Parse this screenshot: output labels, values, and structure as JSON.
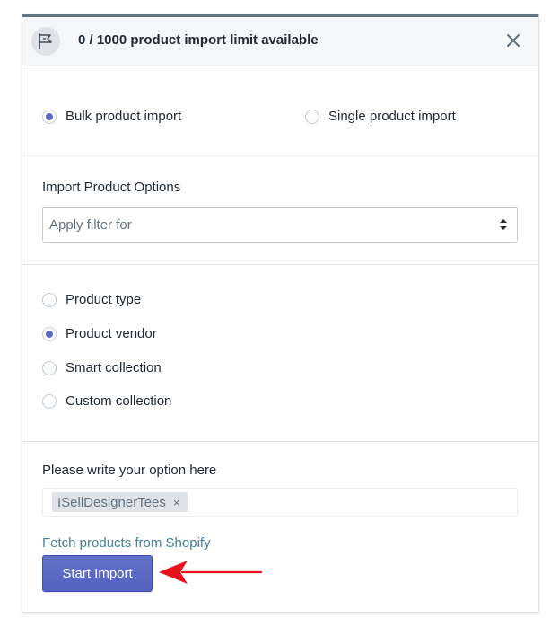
{
  "header": {
    "title": "0 / 1000 product import limit available",
    "icon": "flag-icon",
    "close_icon": "close-icon"
  },
  "import_mode": {
    "options": [
      {
        "label": "Bulk product import",
        "checked": true
      },
      {
        "label": "Single product import",
        "checked": false
      }
    ]
  },
  "import_options": {
    "label": "Import Product Options",
    "select_value": "Apply filter for"
  },
  "filter_types": {
    "options": [
      {
        "label": "Product type",
        "checked": false
      },
      {
        "label": "Product vendor",
        "checked": true
      },
      {
        "label": "Smart collection",
        "checked": false
      },
      {
        "label": "Custom collection",
        "checked": false
      }
    ]
  },
  "option_input": {
    "label": "Please write your option here",
    "tags": [
      "ISellDesignerTees"
    ],
    "remove_glyph": "×"
  },
  "fetch_link": "Fetch products from Shopify",
  "start_button": "Start Import",
  "colors": {
    "accent": "#5c6ac4",
    "link": "#47819e",
    "annotation_arrow": "#e8101c"
  }
}
